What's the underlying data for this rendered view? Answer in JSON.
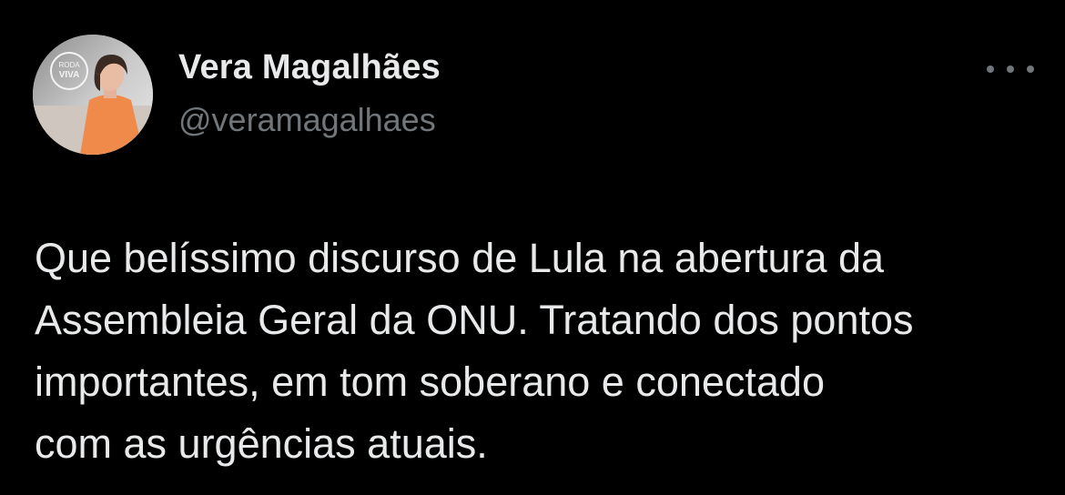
{
  "author": {
    "display_name": "Vera Magalhães",
    "handle": "@veramagalhaes",
    "avatar_text": "RODA VIVA"
  },
  "tweet": {
    "text": "Que belíssimo discurso de Lula na abertura da\nAssembleia Geral da ONU. Tratando dos pontos\nimportantes, em tom soberano e conectado\ncom as urgências atuais."
  },
  "icons": {
    "more": "more-horizontal-icon"
  },
  "colors": {
    "background": "#000000",
    "primary_text": "#e7e9ea",
    "secondary_text": "#71767b",
    "avatar_shirt": "#f08a4b"
  }
}
